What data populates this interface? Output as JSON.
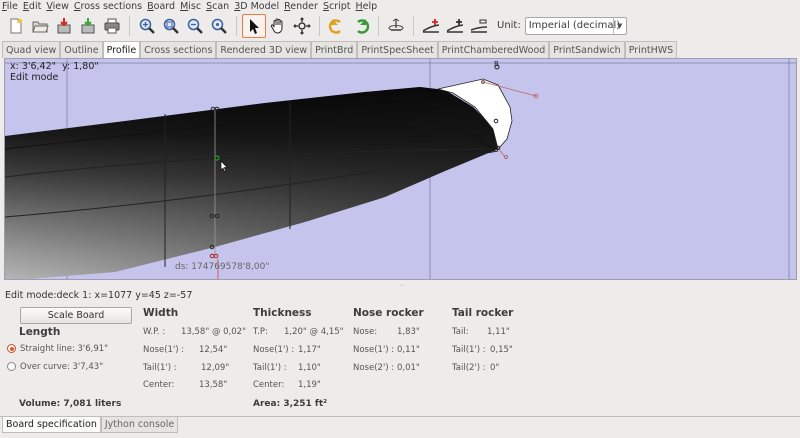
{
  "menu": [
    "File",
    "Edit",
    "View",
    "Cross sections",
    "Board",
    "Misc",
    "Scan",
    "3D Model",
    "Render",
    "Script",
    "Help"
  ],
  "toolbar": {
    "unit_label": "Unit:",
    "unit_value": "Imperial (decimal)",
    "icons": [
      "new-file-icon",
      "open-folder-icon",
      "save-icon",
      "save-as-icon",
      "print-icon",
      "zoom-in-icon",
      "zoom-fit-icon",
      "zoom-out-icon",
      "zoom-area-icon",
      "select-arrow-icon",
      "pan-hand-icon",
      "orbit-icon",
      "undo-icon",
      "redo-icon",
      "spin-icon",
      "add-point-icon",
      "add-ghost-point-icon",
      "add-deck-icon"
    ]
  },
  "tabs": [
    "Quad view",
    "Outline",
    "Profile",
    "Cross sections",
    "Rendered 3D view",
    "PrintBrd",
    "PrintSpecSheet",
    "PrintChamberedWood",
    "PrintSandwich",
    "PrintHWS"
  ],
  "active_tab": "Profile",
  "viewport": {
    "coord_x": "x: 3'6,42\"",
    "coord_y": "y: 1,80\"",
    "mode_label": "Edit mode",
    "dims_text": "ds: 174769578'8,00\"",
    "marker_label": "B"
  },
  "status_line": "Edit mode:deck 1: x=1077 y=45 z=-57",
  "spec": {
    "scale_button": "Scale Board",
    "length": {
      "title": "Length",
      "straight": "Straight line: 3'6,91\"",
      "curve": "Over curve: 3'7,43\"",
      "selected": "straight"
    },
    "volume": "Volume: 7,081 liters",
    "width": {
      "title": "Width",
      "rows": [
        {
          "label": "W.P. :",
          "value": "13,58\" @ 0,02\""
        },
        {
          "label": "Nose(1') :",
          "value": "12,54\""
        },
        {
          "label": "Tail(1') :",
          "value": "12,09\""
        },
        {
          "label": "Center:",
          "value": "13,58\""
        }
      ]
    },
    "thickness": {
      "title": "Thickness",
      "rows": [
        {
          "label": "T.P:",
          "value": "1,20\" @ 4,15\""
        },
        {
          "label": "Nose(1') :",
          "value": "1,17\""
        },
        {
          "label": "Tail(1') :",
          "value": "1,10\""
        },
        {
          "label": "Center:",
          "value": "1,19\""
        }
      ]
    },
    "area": "Area: 3,251 ft²",
    "nose_rocker": {
      "title": "Nose rocker",
      "rows": [
        {
          "label": "Nose:",
          "value": "1,83\""
        },
        {
          "label": "Nose(1') :",
          "value": "0,11\""
        },
        {
          "label": "Nose(2') :",
          "value": "0,01\""
        }
      ]
    },
    "tail_rocker": {
      "title": "Tail rocker",
      "rows": [
        {
          "label": "Tail:",
          "value": "1,11\""
        },
        {
          "label": "Tail(1') :",
          "value": "0,15\""
        },
        {
          "label": "Tail(2') :",
          "value": "0\""
        }
      ]
    }
  },
  "bottom_tabs": [
    "Board specification",
    "Jython console"
  ],
  "active_bottom_tab": "Board specification"
}
